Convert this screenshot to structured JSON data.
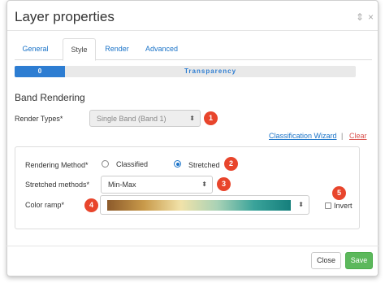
{
  "window": {
    "title": "Layer properties",
    "minimize_glyph": "⇕",
    "close_glyph": "×"
  },
  "tabs": [
    {
      "label": "General",
      "active": false
    },
    {
      "label": "Style",
      "active": true
    },
    {
      "label": "Render",
      "active": false
    },
    {
      "label": "Advanced",
      "active": false
    }
  ],
  "transparency": {
    "value": "0",
    "label": "Transparency",
    "fill_fraction": 0.147,
    "color": "#2d7dd2"
  },
  "band_rendering": {
    "section_title": "Band Rendering",
    "render_types_label": "Render Types*",
    "render_types_value": "Single Band (Band 1)",
    "classification_wizard": "Classification Wizard",
    "separator": "|",
    "clear": "Clear"
  },
  "rendering": {
    "method_label": "Rendering Method*",
    "option_classified": "Classified",
    "option_stretched": "Stretched",
    "selected": "Stretched",
    "stretched_methods_label": "Stretched methods*",
    "stretched_methods_value": "Min-Max",
    "color_ramp_label": "Color ramp*",
    "color_ramp_colors": [
      "#8c5a2b",
      "#c99a4a",
      "#f1e2a9",
      "#a9d2b6",
      "#3aa39a",
      "#157f7c"
    ],
    "invert_label": "Invert",
    "invert_checked": false
  },
  "badges": [
    "1",
    "2",
    "3",
    "4",
    "5"
  ],
  "badge_color": "#e8452c",
  "footer": {
    "close": "Close",
    "save": "Save"
  },
  "icons": {
    "select_caret": "⬍",
    "minimize": "resize-icon",
    "close": "close-icon"
  }
}
